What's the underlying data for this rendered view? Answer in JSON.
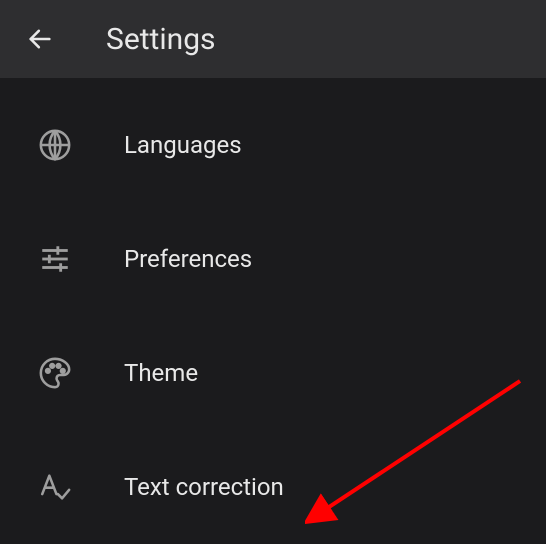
{
  "header": {
    "title": "Settings"
  },
  "menu": {
    "items": [
      {
        "icon": "globe",
        "label": "Languages"
      },
      {
        "icon": "sliders",
        "label": "Preferences"
      },
      {
        "icon": "palette",
        "label": "Theme"
      },
      {
        "icon": "text-correction",
        "label": "Text correction"
      }
    ]
  }
}
